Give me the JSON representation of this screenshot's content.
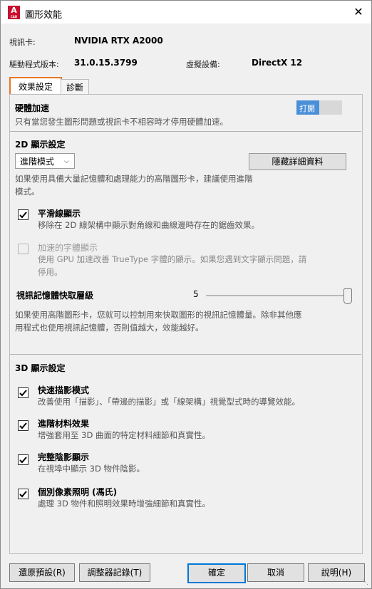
{
  "window": {
    "title": "圖形效能",
    "app_icon_letter": "A",
    "app_icon_sub": "CAD",
    "close_glyph": "✕"
  },
  "info": {
    "graphics_card_label": "視訊卡:",
    "graphics_card_value": "NVIDIA RTX A2000",
    "driver_label": "驅動程式版本:",
    "driver_value": "31.0.15.3799",
    "virtual_device_label": "虛擬設備:",
    "virtual_device_value": "DirectX 12"
  },
  "tabs": [
    {
      "label": "效果設定",
      "active": true
    },
    {
      "label": "診斷",
      "active": false
    }
  ],
  "hardware": {
    "title": "硬體加速",
    "toggle_label": "打開",
    "toggle_on": true,
    "description": "只有當您發生圖形問題或視訊卡不相容時才停用硬體加速。"
  },
  "display2d": {
    "title": "2D 顯示設定",
    "mode_value": "進階模式",
    "hide_details_label": "隱藏詳細資料",
    "description_line1": "如果使用具備大量記憶體和處理能力的高階圖形卡，建議使用進階",
    "description_line2": "模式。",
    "options": [
      {
        "title": "平滑線顯示",
        "checked": true,
        "enabled": true,
        "desc1": "移除在 2D 線架構中顯示對角線和曲線邊時存在的鋸齒效果。",
        "desc2": ""
      },
      {
        "title": "加速的字體顯示",
        "checked": false,
        "enabled": false,
        "desc1": "使用 GPU 加速改善 TrueType 字體的顯示。如果您遇到文字顯示問題，請",
        "desc2": "停用。"
      }
    ],
    "cache_label": "視訊記憶體快取層級",
    "cache_value": "5",
    "cache_level_fraction": 1.0,
    "cache_desc1": "如果使用高階圖形卡，您就可以控制用來快取圖形的視訊記憶體量。除非其他應",
    "cache_desc2": "用程式也使用視訊記憶體，否則值越大，效能越好。"
  },
  "display3d": {
    "title": "3D 顯示設定",
    "options": [
      {
        "title": "快速描影模式",
        "checked": true,
        "desc": "改善使用「描影」、「帶邊的描影」或「線架構」視覺型式時的導覽效能。"
      },
      {
        "title": "進階材料效果",
        "checked": true,
        "desc": "增強套用至 3D 曲面的特定材料細節和真實性。"
      },
      {
        "title": "完整陰影顯示",
        "checked": true,
        "desc": "在視埠中顯示 3D 物件陰影。"
      },
      {
        "title": "個別像素照明 (馮氏)",
        "checked": true,
        "desc": "處理 3D 物件和照明效果時增強細節和真實性。"
      }
    ]
  },
  "footer": {
    "reset_label": "還原預設(R)",
    "log_label": "調整器記錄(T)",
    "ok_label": "確定",
    "cancel_label": "取消",
    "help_label": "說明(H)"
  },
  "colors": {
    "accent_tab": "#e87722",
    "toggle_on": "#4a90d9",
    "primary_border": "#0078d7",
    "app_icon": "#c8102e"
  }
}
